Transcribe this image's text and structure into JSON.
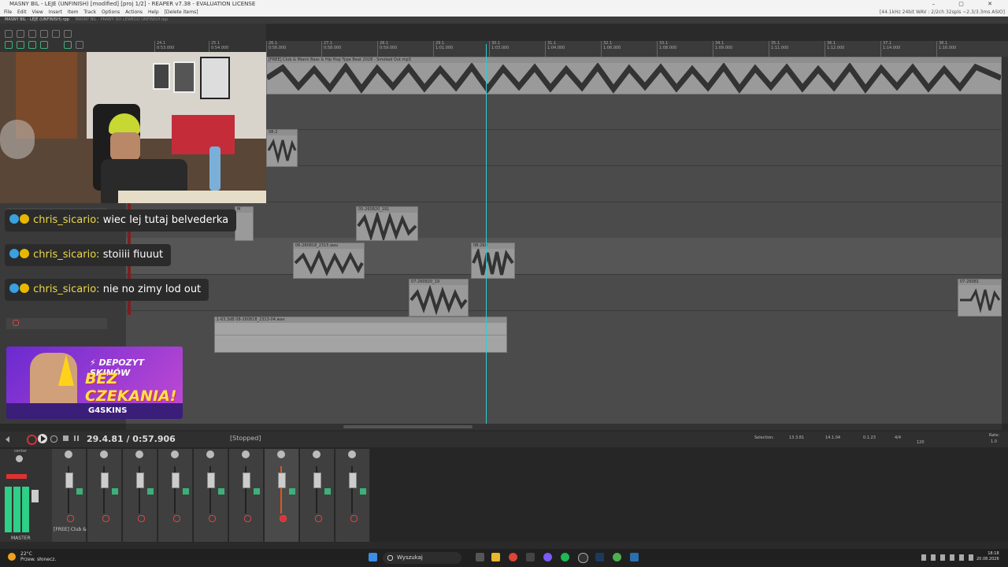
{
  "window": {
    "title": "MASNY BIL - LEJE (UNFINISH) [modified] [proj 1/2] - REAPER v7.38 - EVALUATION LICENSE",
    "controls": "– ▢ ✕"
  },
  "menu": {
    "items": [
      "File",
      "Edit",
      "View",
      "Insert",
      "Item",
      "Track",
      "Options",
      "Actions",
      "Help",
      "[Delete items]"
    ],
    "audio_info": "[44.1kHz 24bit WAV : 2/2ch 32spls ~2.3/3.3ms ASIO]"
  },
  "project_tabs": [
    "MASNY BIL - LEJE (UNFINISH).rpp",
    "MASNY BIL - PRAWY DO LEWEGO UNFINISH.rpp"
  ],
  "ruler": {
    "marks": [
      {
        "label": "24.1",
        "time": "0:53.000"
      },
      {
        "label": "25.1",
        "time": "0:54.000"
      },
      {
        "label": "26.1",
        "time": "0:56.000"
      },
      {
        "label": "27.1",
        "time": "0:58.000"
      },
      {
        "label": "28.1",
        "time": "0:59.000"
      },
      {
        "label": "29.1",
        "time": "1:01.000"
      },
      {
        "label": "30.1",
        "time": "1:03.000"
      },
      {
        "label": "31.1",
        "time": "1:04.000"
      },
      {
        "label": "32.1",
        "time": "1:06.000"
      },
      {
        "label": "33.1",
        "time": "1:08.000"
      },
      {
        "label": "34.1",
        "time": "1:09.000"
      },
      {
        "label": "35.1",
        "time": "1:11.000"
      },
      {
        "label": "36.1",
        "time": "1:12.000"
      },
      {
        "label": "37.1",
        "time": "1:14.000"
      },
      {
        "label": "38.1",
        "time": "1:16.000"
      }
    ]
  },
  "items": {
    "beat": "[FREE] Club & Miami Bass & Hip Hop Type Beat 2028 - Smoked Out.mp3",
    "vocal1": "08-2",
    "vocal2": "05-260820_191",
    "vocal3": "06-260818_2315.wav",
    "vocal4": "08-260",
    "vocal5": "07-260820_19",
    "vocal6": "07-26081",
    "vocal7": "1-63.3dB 08-260818_2313-04.wav",
    "small": "M"
  },
  "chat": [
    {
      "user": "chris_sicario:",
      "message": "wiec lej tutaj belvederka"
    },
    {
      "user": "chris_sicario:",
      "message": "stoiiii fiuuut"
    },
    {
      "user": "chris_sicario:",
      "message": "nie no zimy lod out"
    }
  ],
  "promo": {
    "line1": "⚡ DEPOZYT SKINÓW",
    "line2": "BEZ CZEKANIA!",
    "brand": "G4SKINS"
  },
  "transport": {
    "position": "29.4.81 / 0:57.906",
    "status": "[Stopped]",
    "selection_label": "Selection:",
    "sel_start": "13.3.81",
    "sel_end": "14.1.04",
    "sel_len": "0.1.23",
    "timesig": "4/4",
    "bpm": "120",
    "rate_label": "Rate:",
    "rate": "1.0"
  },
  "mixer": {
    "master_label": "MASTER",
    "track_name": "[FREE] Club &",
    "center": "center",
    "strip_count": 9
  },
  "taskbar": {
    "search": "Wyszukaj",
    "temp": "22°C",
    "weather": "Przew. słonecz.",
    "time": "18:18",
    "date": "20.08.2026"
  },
  "colors": {
    "playhead": "#33cccc",
    "accent_green": "#3db07a",
    "record_red": "#dd4444",
    "chat_user": "#ecd94a"
  }
}
